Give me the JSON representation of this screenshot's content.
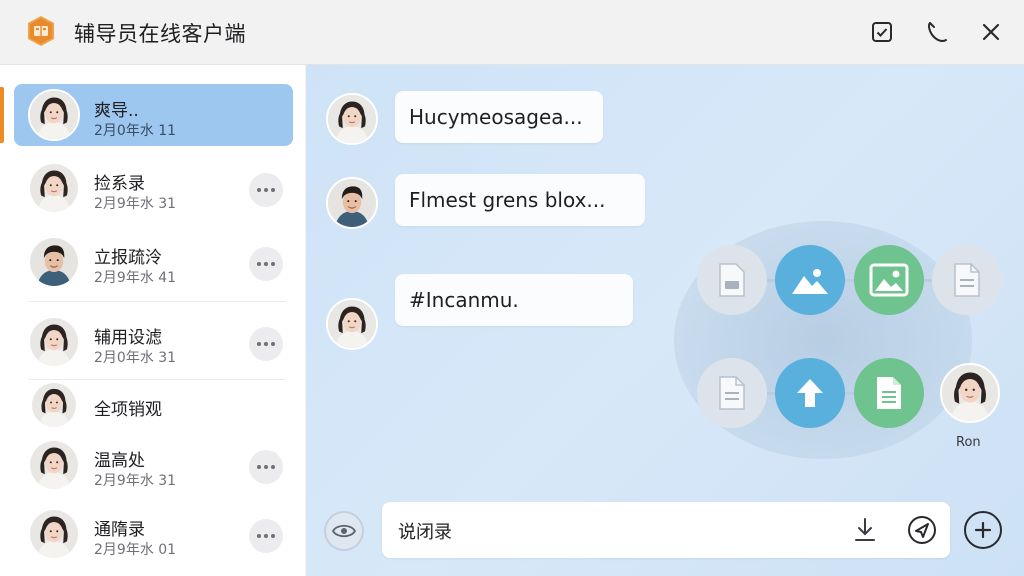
{
  "window": {
    "title": "辅导员在线客户端"
  },
  "titlebar_icons": [
    "checkbox-icon",
    "phone-icon",
    "close-icon"
  ],
  "contacts": [
    {
      "name": "爽导..",
      "sub": "2月0年水 11",
      "active": true
    },
    {
      "name": "捡系录",
      "sub": "2月9年水 31"
    },
    {
      "name": "立报疏泠",
      "sub": "2月9年水 41"
    },
    {
      "name": "辅用设滤",
      "sub": "2月0年水 31"
    },
    {
      "name": "全项销观",
      "sub": ""
    },
    {
      "name": "温高处",
      "sub": "2月9年水 31"
    },
    {
      "name": "通隋录",
      "sub": "2月9年水 01"
    }
  ],
  "messages": [
    {
      "text": "Hucymeosagea..."
    },
    {
      "text": "Flmest grens blox..."
    },
    {
      "text": "#Incanmu."
    }
  ],
  "attachments": {
    "row1": [
      "file-icon",
      "image-icon",
      "picture-icon",
      "document-icon"
    ],
    "row2": [
      "document-icon",
      "upload-icon",
      "spreadsheet-icon"
    ],
    "user_label": "Ron"
  },
  "composer": {
    "value": "说闭录"
  },
  "colors": {
    "accent": "#f08a24",
    "active_row": "#9ec7f0",
    "chat_bg": "#d3e6f8",
    "blue_btn": "#5ab0dc",
    "green_btn": "#6fc38f"
  }
}
